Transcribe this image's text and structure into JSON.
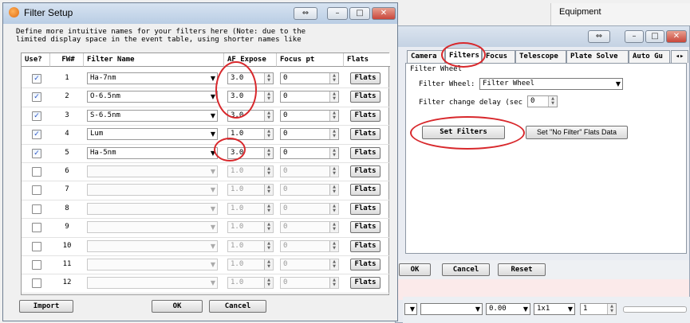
{
  "dialog": {
    "title": "Filter Setup",
    "description_line1": "Define more intuitive names for your filters here (Note: due to the",
    "description_line2": "limited display space in the event table, using shorter names like",
    "columns": [
      "Use?",
      "FW#",
      "Filter Name",
      "AF Expose",
      "Focus pt",
      "Flats"
    ],
    "rows": [
      {
        "use": true,
        "fw": "1",
        "name": "Ha-7nm",
        "af": "3.0",
        "focus": "0",
        "flats": "Flats"
      },
      {
        "use": true,
        "fw": "2",
        "name": "O-6.5nm",
        "af": "3.0",
        "focus": "0",
        "flats": "Flats"
      },
      {
        "use": true,
        "fw": "3",
        "name": "S-6.5nm",
        "af": "3.0",
        "focus": "0",
        "flats": "Flats"
      },
      {
        "use": true,
        "fw": "4",
        "name": "Lum",
        "af": "1.0",
        "focus": "0",
        "flats": "Flats"
      },
      {
        "use": true,
        "fw": "5",
        "name": "Ha-5nm",
        "af": "3.0",
        "focus": "0",
        "flats": "Flats"
      },
      {
        "use": false,
        "fw": "6",
        "name": "",
        "af": "1.0",
        "focus": "0",
        "flats": "Flats"
      },
      {
        "use": false,
        "fw": "7",
        "name": "",
        "af": "1.0",
        "focus": "0",
        "flats": "Flats"
      },
      {
        "use": false,
        "fw": "8",
        "name": "",
        "af": "1.0",
        "focus": "0",
        "flats": "Flats"
      },
      {
        "use": false,
        "fw": "9",
        "name": "",
        "af": "1.0",
        "focus": "0",
        "flats": "Flats"
      },
      {
        "use": false,
        "fw": "10",
        "name": "",
        "af": "1.0",
        "focus": "0",
        "flats": "Flats"
      },
      {
        "use": false,
        "fw": "11",
        "name": "",
        "af": "1.0",
        "focus": "0",
        "flats": "Flats"
      },
      {
        "use": false,
        "fw": "12",
        "name": "",
        "af": "1.0",
        "focus": "0",
        "flats": "Flats"
      }
    ],
    "import_label": "Import",
    "ok_label": "OK",
    "cancel_label": "Cancel"
  },
  "main_window": {
    "equipment_label": "Equipment",
    "tabs": [
      "Camera",
      "Filters",
      "Focus",
      "Telescope",
      "Plate Solve",
      "Auto Gu"
    ],
    "group_label": "Filter Wheel",
    "filter_wheel_label": "Filter Wheel:",
    "filter_wheel_value": "Filter Wheel",
    "delay_label": "Filter change delay (sec",
    "delay_value": "0",
    "set_filters_label": "Set Filters",
    "set_no_filter_label": "Set \"No Filter\" Flats Data",
    "ok_label": "OK",
    "cancel_label": "Cancel",
    "reset_label": "Reset",
    "bottom_time": "0.00",
    "bottom_binning": "1x1",
    "bottom_count": "1"
  },
  "colors": {
    "highlight": "#d8282c",
    "check": "#2b58c9"
  }
}
